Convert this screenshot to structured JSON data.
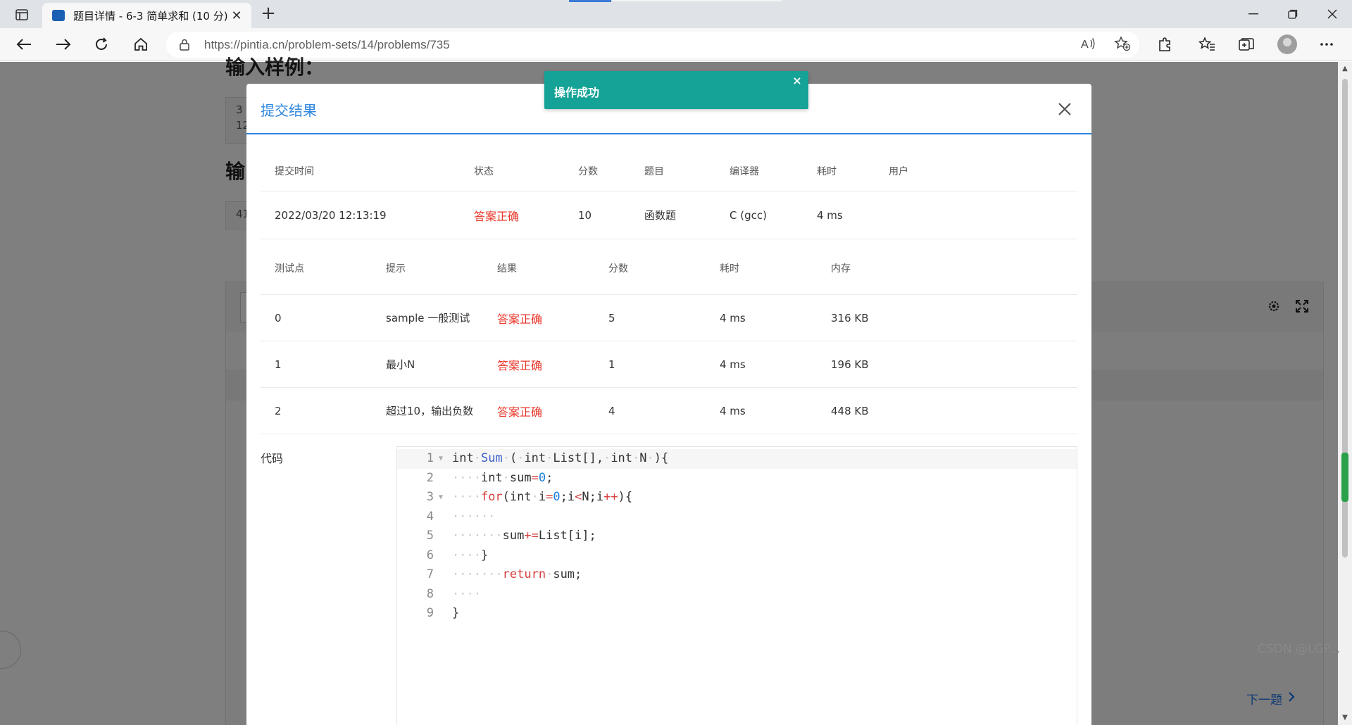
{
  "browser": {
    "tab_title": "题目详情 - 6-3 简单求和 (10 分)",
    "tab_close": "✕",
    "new_tab": "+",
    "url": "https://pintia.cn/problem-sets/14/problems/735"
  },
  "background_page": {
    "heading1": "输入样例：",
    "sample_input": [
      "3",
      "12"
    ],
    "heading2": "输",
    "sample_output": "41",
    "next_link": "下一题",
    "watermark": "CSDN @LGP..."
  },
  "toast": {
    "message": "操作成功",
    "close": "×"
  },
  "modal": {
    "title": "提交结果",
    "summary": {
      "headers": [
        "提交时间",
        "状态",
        "分数",
        "题目",
        "编译器",
        "耗时",
        "用户"
      ],
      "row": [
        "2022/03/20 12:13:19",
        "答案正确",
        "10",
        "函数题",
        "C (gcc)",
        "4 ms",
        ""
      ]
    },
    "cases": {
      "headers": [
        "测试点",
        "提示",
        "结果",
        "分数",
        "耗时",
        "内存"
      ],
      "rows": [
        [
          "0",
          "sample 一般测试",
          "答案正确",
          "5",
          "4 ms",
          "316 KB"
        ],
        [
          "1",
          "最小N",
          "答案正确",
          "1",
          "4 ms",
          "196 KB"
        ],
        [
          "2",
          "超过10，输出负数",
          "答案正确",
          "4",
          "4 ms",
          "448 KB"
        ]
      ]
    },
    "code_label": "代码",
    "code_line_numbers": [
      "1",
      "2",
      "3",
      "4",
      "5",
      "6",
      "7",
      "8",
      "9"
    ]
  },
  "colors": {
    "accent": "#2e86de",
    "success_toast": "#14a396",
    "status_ok": "#e8372a"
  }
}
